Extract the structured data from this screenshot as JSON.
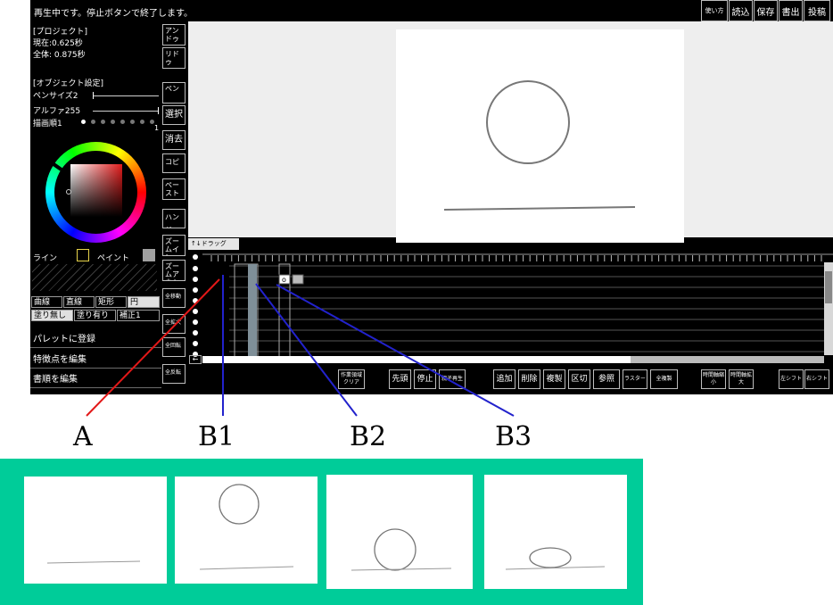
{
  "status_message": "再生中です。停止ボタンで終了します。",
  "toolbar": {
    "help": "使い方",
    "load": "読込",
    "save": "保存",
    "export": "書出",
    "post": "投稿"
  },
  "project": {
    "heading": "[プロジェクト]",
    "current": "現在:0.625秒",
    "total": "全体: 0.875秒"
  },
  "object_settings": {
    "heading": "[オブジェクト設定]",
    "pen_size": "ペンサイズ2",
    "alpha": "アルファ255",
    "draw_order": "描画順1",
    "draw_order_value": "1"
  },
  "colors": {
    "line_label": "ライン",
    "paint_label": "ペイント",
    "line_swatch": "#e8d44a",
    "paint_swatch": "#a0a0a0",
    "accent": "#00cc99"
  },
  "shape_modes": [
    "曲線",
    "直線",
    "矩形",
    "円"
  ],
  "fill_modes": [
    "塗り無し",
    "塗り有り",
    "補正1"
  ],
  "menu": [
    "パレットに登録",
    "特徴点を編集",
    "書順を編集"
  ],
  "tools": [
    "アンドゥ",
    "リドゥ",
    "ペン",
    "選択",
    "消去",
    "コピー",
    "ペースト",
    "ハンド",
    "ズームイン",
    "ズームアウト",
    "全移動",
    "全拡大",
    "全回転",
    "全反転"
  ],
  "timeline": {
    "tab_label": "↑↓ドラッグ",
    "frame_marker": "o",
    "arrow_left": "←"
  },
  "bottom_buttons": [
    "作業領域クリア",
    "先頭",
    "停止",
    "親子再生",
    "追加",
    "削除",
    "複製",
    "区切",
    "参照",
    "ラスター",
    "全複製",
    "時間軸縮小",
    "時間軸拡大",
    "左シフト",
    "右シフト"
  ],
  "callouts": [
    "A",
    "B1",
    "B2",
    "B3"
  ]
}
